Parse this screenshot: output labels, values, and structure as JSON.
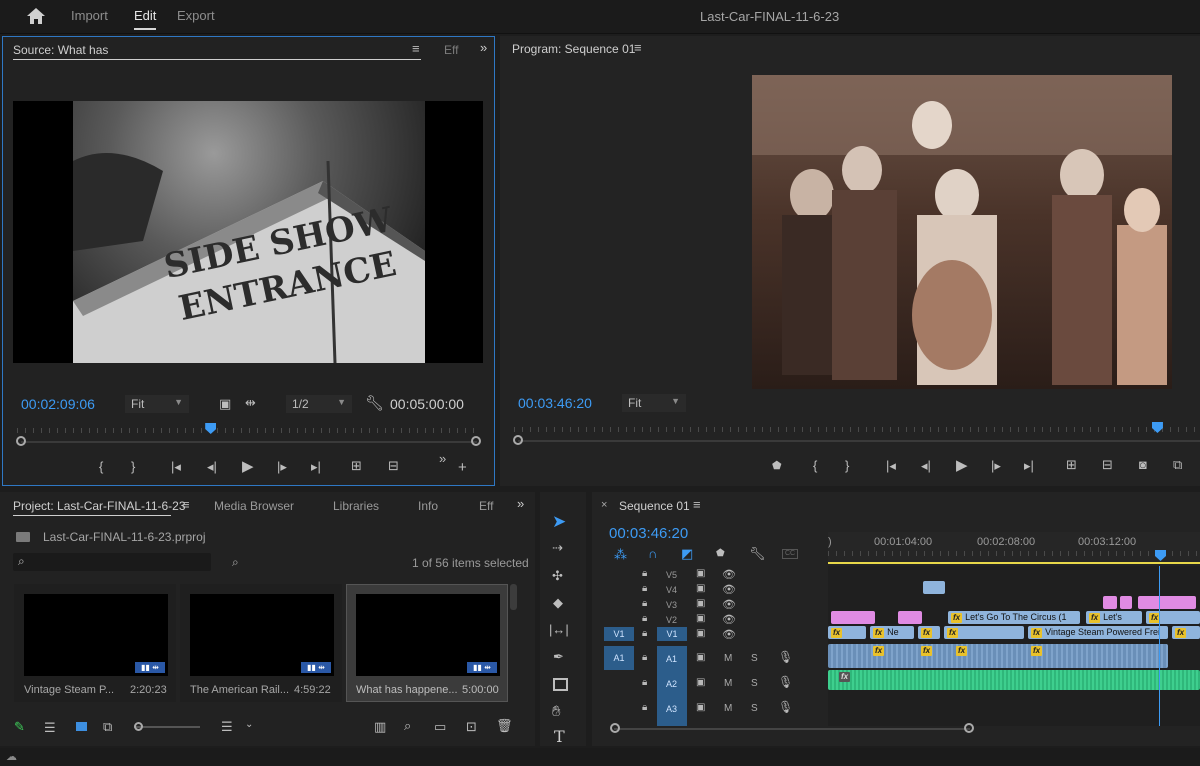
{
  "topbar": {
    "nav": [
      "Import",
      "Edit",
      "Export"
    ],
    "project_title": "Last-Car-FINAL-11-6-23"
  },
  "source": {
    "tab": "Source: What has",
    "effects_tab": "Eff",
    "timecode": "00:02:09:06",
    "zoom": "Fit",
    "resolution": "1/2",
    "duration": "00:05:00:00",
    "image_text": "SIDE SHOW ENTRANCE",
    "playhead": 0.42
  },
  "program": {
    "tab": "Program: Sequence 01",
    "timecode": "00:03:46:20",
    "zoom": "Fit",
    "playhead": 0.94
  },
  "project": {
    "tabs": [
      "Project: Last-Car-FINAL-11-6-23",
      "Media Browser",
      "Libraries",
      "Info",
      "Eff"
    ],
    "file": "Last-Car-FINAL-11-6-23.prproj",
    "search_placeholder": "",
    "selection_status": "1 of 56 items selected",
    "items": [
      {
        "name": "Vintage Steam P...",
        "duration": "2:20:23",
        "selected": false
      },
      {
        "name": "The American Rail...",
        "duration": "4:59:22",
        "selected": false
      },
      {
        "name": "What has happene...",
        "duration": "5:00:00",
        "selected": true
      }
    ]
  },
  "timeline": {
    "tab": "Sequence 01",
    "timecode": "00:03:46:20",
    "ruler": [
      "00:01:04:00",
      "00:02:08:00",
      "00:03:12:00"
    ],
    "video_tracks": [
      "V5",
      "V4",
      "V3",
      "V2",
      "V1"
    ],
    "audio_tracks": [
      "A1",
      "A2",
      "A3"
    ],
    "source_v": "V1",
    "source_a": "A1",
    "mute": "M",
    "solo": "S",
    "clips": {
      "v2_a": "Let's Go To The Circus (1",
      "v2_b": "Let's",
      "v1_a": "Ne",
      "v1_b": "Vintage Steam Powered Frei",
      "fx": "fx"
    }
  },
  "colors": {
    "accent": "#3d9bf4",
    "video_clip": "#8fb4dc",
    "pink_clip": "#e08be3",
    "audio_clip": "#6a8fb8",
    "audio_green": "#3ecf8e",
    "playhead": "#3d9bf4",
    "work_area": "#e8d84a"
  }
}
